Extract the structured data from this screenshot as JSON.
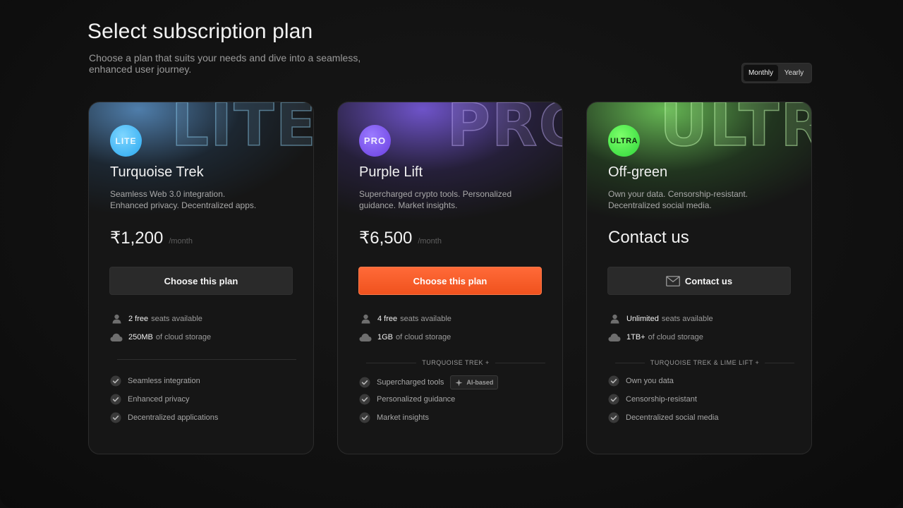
{
  "header": {
    "title": "Select subscription plan",
    "subtitle": "Choose a plan that suits your needs and dive into a seamless, enhanced user journey."
  },
  "billing_toggle": {
    "options": [
      "Monthly",
      "Yearly"
    ],
    "selected": "Monthly"
  },
  "plans": [
    {
      "watermark": "LITE",
      "badge": "LITE",
      "name": "Turquoise Trek",
      "description_line1": "Seamless Web 3.0 integration.",
      "description_line2": "Enhanced privacy. Decentralized apps.",
      "price": "₹1,200",
      "price_unit": "/month",
      "cta": "Choose this plan",
      "features": [
        {
          "highlight": "2 free",
          "text": "seats available",
          "icon": "user-icon"
        },
        {
          "highlight": "250MB",
          "text": "of cloud storage",
          "icon": "cloud-icon"
        }
      ],
      "divider_label": "",
      "benefits": [
        {
          "text": "Seamless integration"
        },
        {
          "text": "Enhanced privacy"
        },
        {
          "text": "Decentralized applications"
        }
      ],
      "accent": "#2aa8f0"
    },
    {
      "watermark": "PRO",
      "badge": "PRO",
      "name": "Purple Lift",
      "description_line1": "Supercharged crypto tools. Personalized",
      "description_line2": "guidance. Market insights.",
      "price": "₹6,500",
      "price_unit": "/month",
      "cta": "Choose this plan",
      "features": [
        {
          "highlight": "4 free",
          "text": "seats available",
          "icon": "user-icon"
        },
        {
          "highlight": "1GB",
          "text": "of cloud storage",
          "icon": "cloud-icon"
        }
      ],
      "divider_label": "TURQUOISE TREK +",
      "benefits": [
        {
          "text": "Supercharged tools",
          "tag": "AI-based"
        },
        {
          "text": "Personalized guidance"
        },
        {
          "text": "Market insights"
        }
      ],
      "accent": "#6a3fe0"
    },
    {
      "watermark": "ULTRA",
      "badge": "ULTRA",
      "name": "Off-green",
      "description_line1": "Own your data. Censorship-resistant.",
      "description_line2": "Decentralized social media.",
      "price": "Contact us",
      "price_unit": "",
      "cta": "Contact us",
      "features": [
        {
          "highlight": "Unlimited",
          "text": "seats available",
          "icon": "user-icon"
        },
        {
          "highlight": "1TB+",
          "text": "of cloud storage",
          "icon": "cloud-icon"
        }
      ],
      "divider_label": "TURQUOISE TREK & LIME LIFT +",
      "benefits": [
        {
          "text": "Own you data"
        },
        {
          "text": "Censorship-resistant"
        },
        {
          "text": "Decentralized social media"
        }
      ],
      "accent": "#2fd63a"
    }
  ],
  "colors": {
    "background": "#111111",
    "card": "#161616",
    "primary_cta": "#f0521e"
  }
}
